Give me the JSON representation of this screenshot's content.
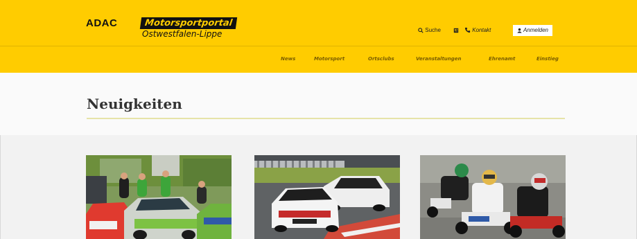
{
  "brand": {
    "adac": "ADAC",
    "portal": "Motorsportportal",
    "region": "Ostwestfalen-Lippe"
  },
  "topnav": {
    "search": "Suche",
    "contact": "Kontakt",
    "login": "Anmelden"
  },
  "mainnav": {
    "items": [
      "News",
      "Motorsport",
      "Ortsclubs",
      "Veranstaltungen",
      "Ehrenamt",
      "Einstieg"
    ]
  },
  "page": {
    "title": "Neuigkeiten"
  },
  "colors": {
    "header": "#ffcc00",
    "nav_text": "#7a5d00",
    "title_rule": "#e6e3a8"
  }
}
